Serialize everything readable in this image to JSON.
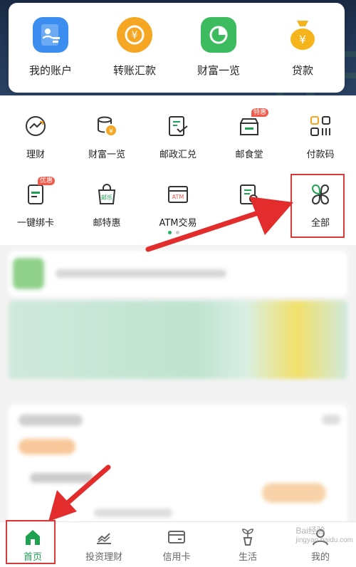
{
  "top_shortcuts": [
    {
      "label": "我的账户",
      "icon": "account-card-icon",
      "color": "#3b8ef0"
    },
    {
      "label": "转账汇款",
      "icon": "transfer-coin-icon",
      "color": "#f5a623"
    },
    {
      "label": "财富一览",
      "icon": "pie-chart-icon",
      "color": "#3dbb5f"
    },
    {
      "label": "贷款",
      "icon": "money-bag-icon",
      "color": "#f5b31c"
    }
  ],
  "grid": [
    {
      "label": "理财",
      "icon": "trend-icon"
    },
    {
      "label": "财富一览",
      "icon": "coin-stack-icon"
    },
    {
      "label": "邮政汇兑",
      "icon": "remit-icon"
    },
    {
      "label": "邮食堂",
      "icon": "shop-icon",
      "tag": "特惠"
    },
    {
      "label": "付款码",
      "icon": "qr-code-icon"
    },
    {
      "label": "一键绑卡",
      "icon": "bind-card-icon",
      "tag": "优惠"
    },
    {
      "label": "邮特惠",
      "icon": "gift-bag-icon",
      "inner": "邮乐"
    },
    {
      "label": "ATM交易",
      "icon": "atm-icon",
      "inner": "ATM"
    },
    {
      "label": "",
      "icon": "search-doc-icon"
    },
    {
      "label": "全部",
      "icon": "four-leaf-icon"
    }
  ],
  "pagination": {
    "current": 1,
    "total": 2
  },
  "bottom_nav": [
    {
      "label": "首页",
      "icon": "home-icon",
      "active": true
    },
    {
      "label": "投资理财",
      "icon": "chart-icon",
      "active": false
    },
    {
      "label": "信用卡",
      "icon": "credit-card-icon",
      "active": false
    },
    {
      "label": "生活",
      "icon": "plant-icon",
      "active": false
    },
    {
      "label": "我的",
      "icon": "user-icon",
      "active": false
    }
  ],
  "watermark": {
    "line1": "Bai经验",
    "line2": "jingyan.baidu.com"
  },
  "colors": {
    "accent": "#1fa152",
    "highlight": "#d63a3a",
    "tag": "#f05a4a"
  }
}
